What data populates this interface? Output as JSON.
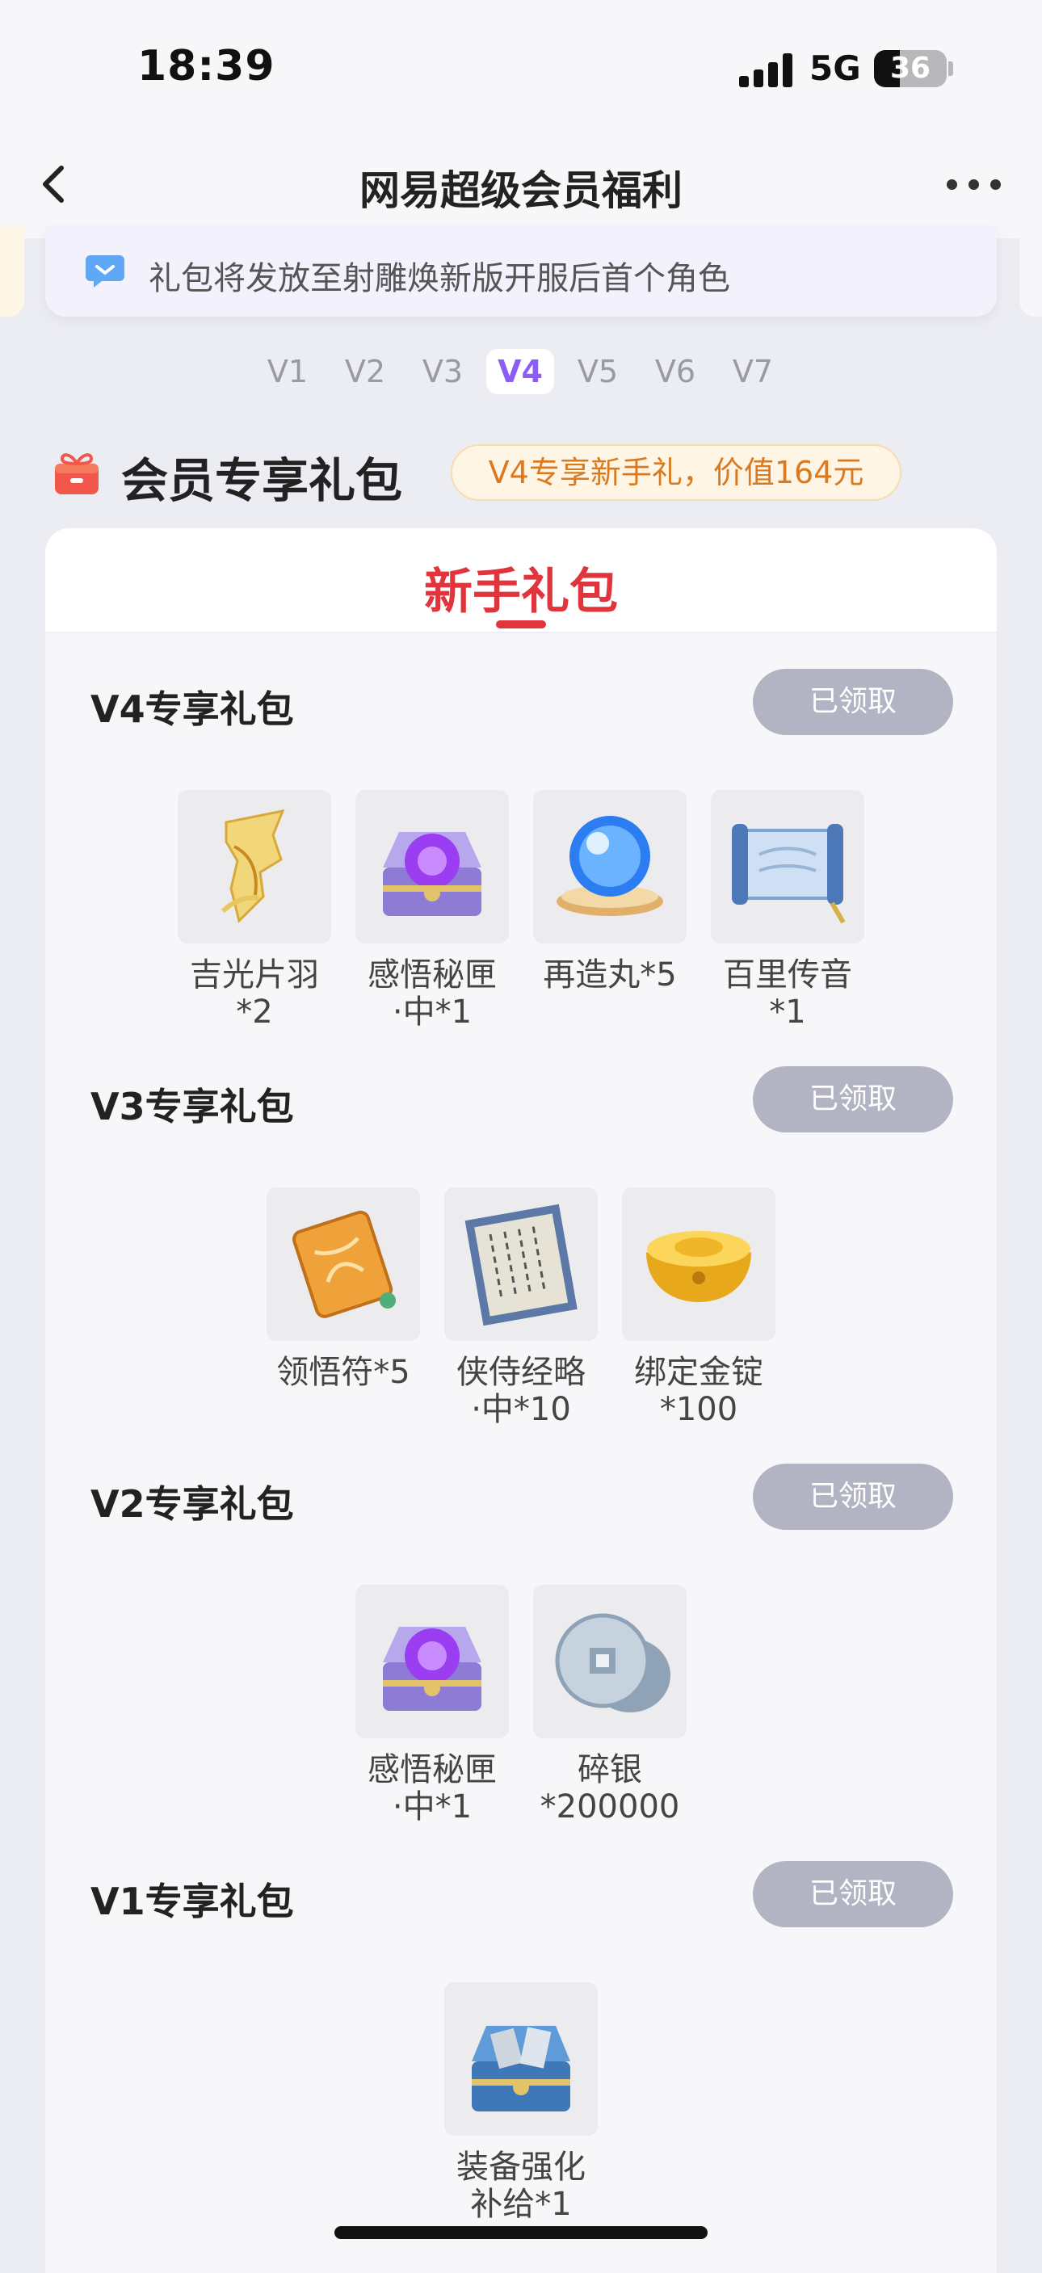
{
  "status_bar": {
    "time": "18:39",
    "network": "5G",
    "battery": "36"
  },
  "nav": {
    "title": "网易超级会员福利"
  },
  "notice": {
    "text": "礼包将发放至射雕焕新版开服后首个角色"
  },
  "levels": {
    "items": [
      "V1",
      "V2",
      "V3",
      "V4",
      "V5",
      "V6",
      "V7"
    ],
    "active": "V4"
  },
  "section": {
    "title": "会员专享礼包",
    "badge": "V4专享新手礼，价值164元"
  },
  "card": {
    "tab": "新手礼包"
  },
  "packs": [
    {
      "title": "V4专享礼包",
      "button": "已领取",
      "items": [
        {
          "icon": "feather-icon",
          "label_1": "吉光片羽",
          "label_2": "*2"
        },
        {
          "icon": "treasure-chest-purple-icon",
          "label_1": "感悟秘匣",
          "label_2": "·中*1"
        },
        {
          "icon": "crystal-orb-icon",
          "label_1": "再造丸*5",
          "label_2": ""
        },
        {
          "icon": "scroll-icon",
          "label_1": "百里传音",
          "label_2": "*1"
        }
      ]
    },
    {
      "title": "V3专享礼包",
      "button": "已领取",
      "items": [
        {
          "icon": "talisman-icon",
          "label_1": "领悟符*5",
          "label_2": ""
        },
        {
          "icon": "manual-book-icon",
          "label_1": "侠侍经略",
          "label_2": "·中*10"
        },
        {
          "icon": "gold-ingot-icon",
          "label_1": "绑定金锭",
          "label_2": "*100"
        }
      ]
    },
    {
      "title": "V2专享礼包",
      "button": "已领取",
      "items": [
        {
          "icon": "treasure-chest-purple-icon",
          "label_1": "感悟秘匣",
          "label_2": "·中*1"
        },
        {
          "icon": "silver-coin-icon",
          "label_1": "碎银",
          "label_2": "*200000"
        }
      ]
    },
    {
      "title": "V1专享礼包",
      "button": "已领取",
      "items": [
        {
          "icon": "equipment-chest-icon",
          "label_1": "装备强化",
          "label_2": "补给*1"
        }
      ]
    }
  ],
  "colors": {
    "accent": "#8b5cf6",
    "red": "#e0353d",
    "badge_text": "#d97a20",
    "claimed_button": "#b3b4c3"
  }
}
